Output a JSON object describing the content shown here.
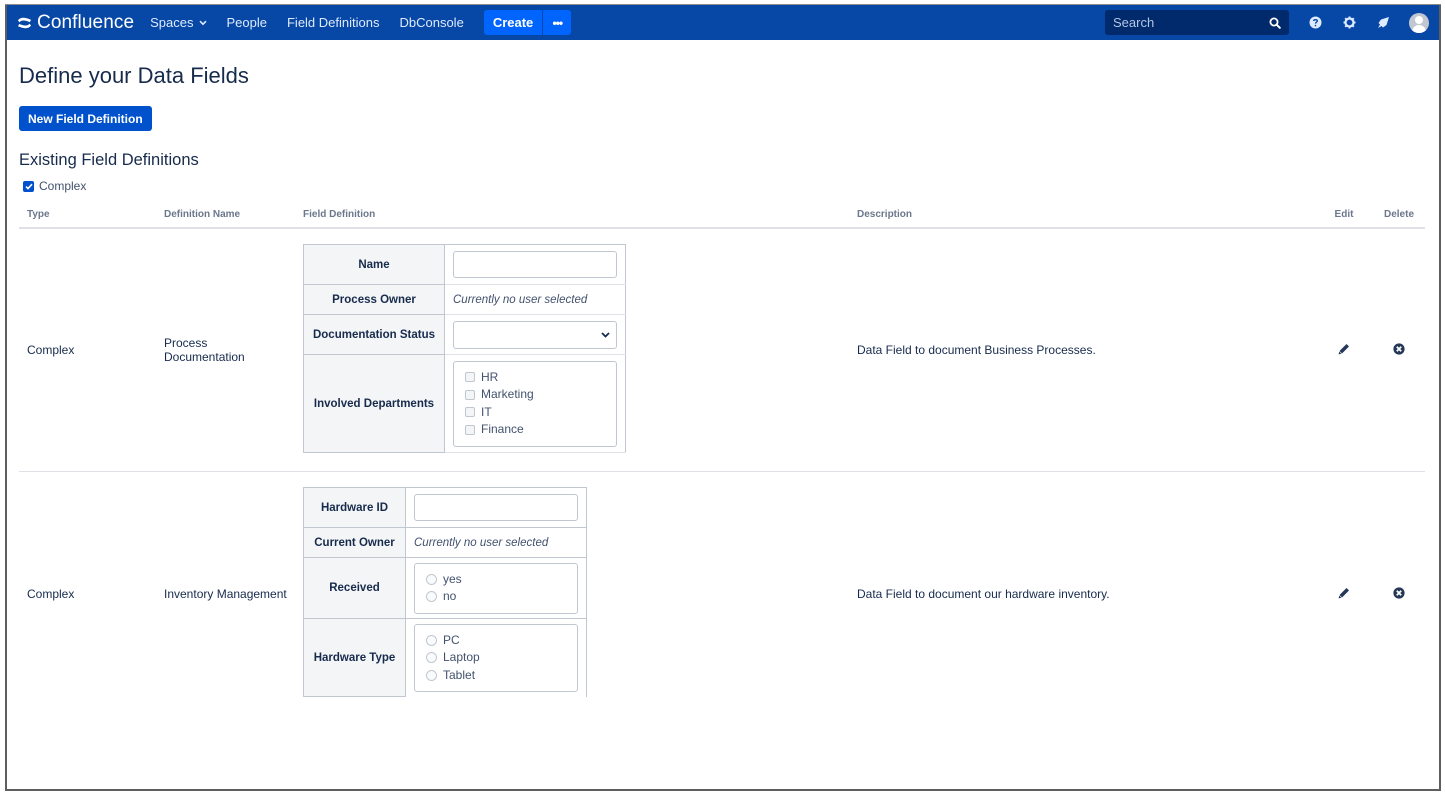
{
  "topnav": {
    "brand": "Confluence",
    "brand_icon": "confluence-logo-icon",
    "items": [
      {
        "label": "Spaces",
        "has_dropdown": true
      },
      {
        "label": "People",
        "has_dropdown": false
      },
      {
        "label": "Field Definitions",
        "has_dropdown": false
      },
      {
        "label": "DbConsole",
        "has_dropdown": false
      }
    ],
    "create_label": "Create",
    "more_label": "•••",
    "search_placeholder": "Search",
    "icons": [
      "search-icon",
      "help-icon",
      "settings-icon",
      "notifications-icon",
      "avatar"
    ]
  },
  "page": {
    "title": "Define your Data Fields",
    "new_button_label": "New Field Definition",
    "section_title": "Existing Field Definitions",
    "filter": {
      "label": "Complex",
      "checked": true
    }
  },
  "table": {
    "headers": {
      "type": "Type",
      "name": "Definition Name",
      "definition": "Field Definition",
      "description": "Description",
      "edit": "Edit",
      "delete": "Delete"
    },
    "rows": [
      {
        "type": "Complex",
        "name": "Process Documentation",
        "description": "Data Field to document Business Processes.",
        "fields": [
          {
            "label": "Name",
            "kind": "text",
            "value": ""
          },
          {
            "label": "Process Owner",
            "kind": "user",
            "placeholder": "Currently no user selected"
          },
          {
            "label": "Documentation Status",
            "kind": "select",
            "value": ""
          },
          {
            "label": "Involved Departments",
            "kind": "checkbox",
            "options": [
              "HR",
              "Marketing",
              "IT",
              "Finance"
            ]
          }
        ]
      },
      {
        "type": "Complex",
        "name": "Inventory Management",
        "description": "Data Field to document our hardware inventory.",
        "fields": [
          {
            "label": "Hardware ID",
            "kind": "text",
            "value": ""
          },
          {
            "label": "Current Owner",
            "kind": "user",
            "placeholder": "Currently no user selected"
          },
          {
            "label": "Received",
            "kind": "radio",
            "options": [
              "yes",
              "no"
            ]
          },
          {
            "label": "Hardware Type",
            "kind": "radio",
            "options": [
              "PC",
              "Laptop",
              "Tablet"
            ]
          }
        ]
      }
    ]
  },
  "colors": {
    "nav_bg": "#0747a6",
    "primary_button": "#0052cc",
    "create_button": "#0065ff",
    "search_bg": "#002a6b",
    "text": "#172b4d",
    "muted_header": "#6b778c"
  }
}
